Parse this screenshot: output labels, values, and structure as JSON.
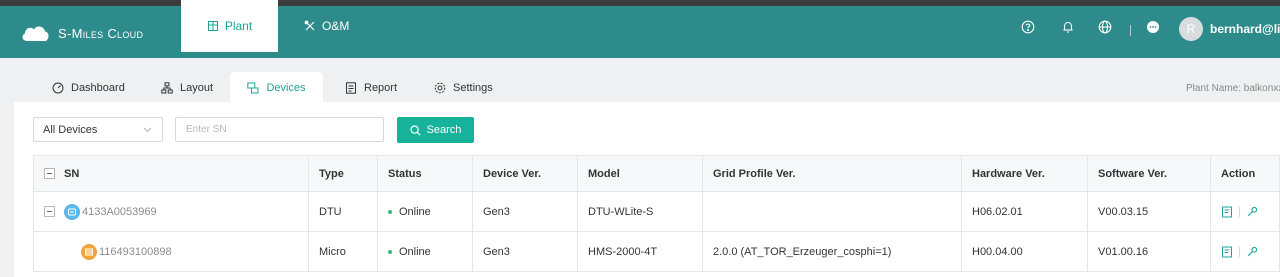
{
  "colors": {
    "topbar": "#2e8b8c",
    "accent": "#1ca596",
    "button": "#16b39a",
    "online": "#2fbf71",
    "dtu_icon": "#5bb8ea",
    "micro_icon": "#f0a43a"
  },
  "brand": {
    "name": "S-Miles Cloud",
    "icon": "cloud-icon"
  },
  "nav": {
    "plant": {
      "label": "Plant",
      "icon": "building-icon"
    },
    "om": {
      "label": "O&M",
      "icon": "tools-icon"
    }
  },
  "header": {
    "icons": [
      "help-icon",
      "bell-icon",
      "globe-icon",
      "chat-icon"
    ],
    "user": {
      "name": "bernhard@libe",
      "avatar_letter": "R"
    }
  },
  "subtabs": [
    {
      "label": "Dashboard",
      "icon": "dashboard-icon"
    },
    {
      "label": "Layout",
      "icon": "layout-icon"
    },
    {
      "label": "Devices",
      "icon": "devices-icon"
    },
    {
      "label": "Report",
      "icon": "report-icon"
    },
    {
      "label": "Settings",
      "icon": "settings-icon"
    }
  ],
  "plant_name": "Plant Name: balkonxx",
  "filter": {
    "device_select": "All Devices",
    "sn_placeholder": "Enter SN",
    "search_label": "Search"
  },
  "table": {
    "columns": [
      "SN",
      "Type",
      "Status",
      "Device Ver.",
      "Model",
      "Grid Profile Ver.",
      "Hardware Ver.",
      "Software Ver.",
      "Action"
    ],
    "rows": [
      {
        "sn": "4133A0053969",
        "type": "DTU",
        "status": "Online",
        "device_ver": "Gen3",
        "model": "DTU-WLite-S",
        "grid_profile": "",
        "hardware": "H06.02.01",
        "software": "V00.03.15"
      },
      {
        "sn": "116493100898",
        "type": "Micro",
        "status": "Online",
        "device_ver": "Gen3",
        "model": "HMS-2000-4T",
        "grid_profile": "2.0.0 (AT_TOR_Erzeuger_cosphi=1)",
        "hardware": "H00.04.00",
        "software": "V01.00.16"
      }
    ]
  }
}
